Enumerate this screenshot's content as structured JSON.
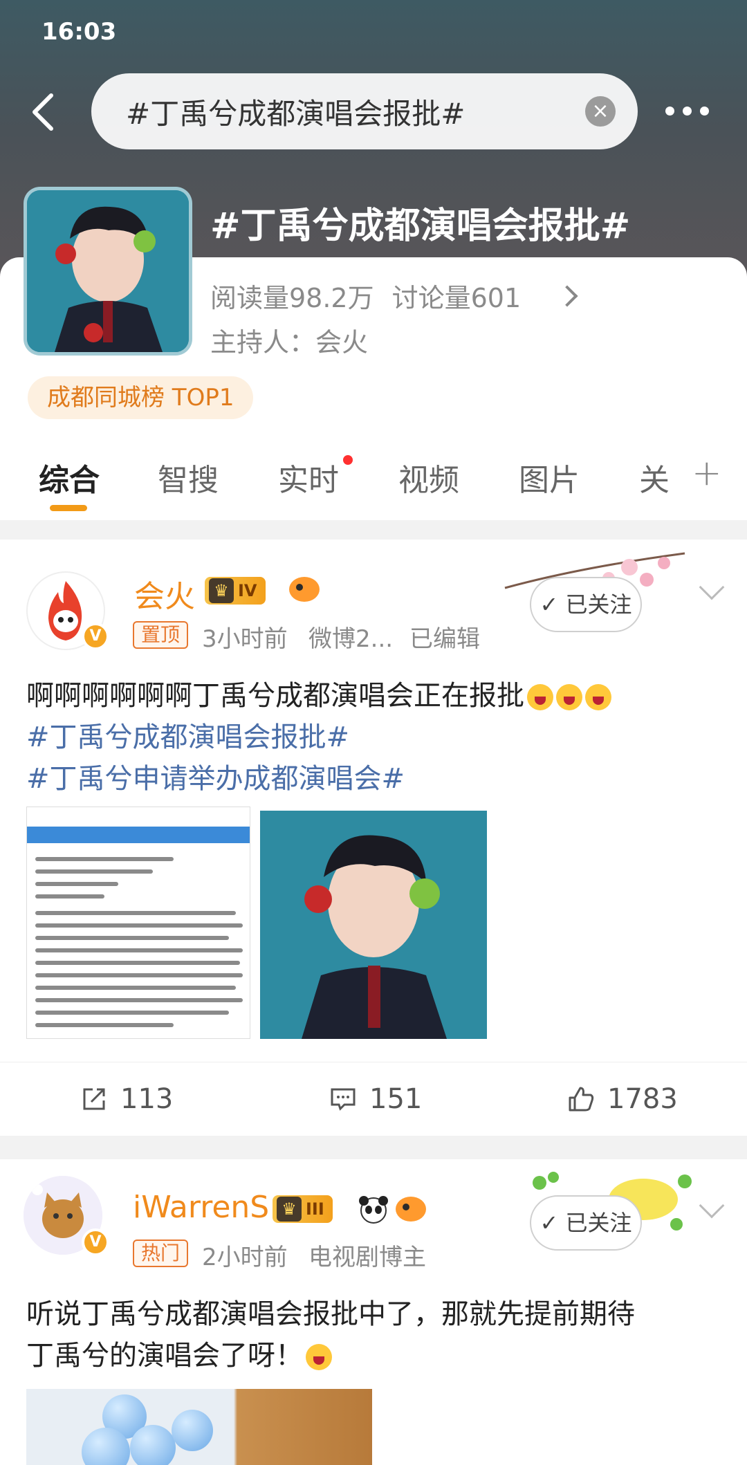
{
  "status": {
    "time": "16:03"
  },
  "search": {
    "query": "#丁禹兮成都演唱会报批#",
    "clear_icon": "close-circle-icon"
  },
  "topic": {
    "title": "#丁禹兮成都演唱会报批#",
    "reads": "阅读量98.2万",
    "discussions": "讨论量601",
    "host": "主持人：会火",
    "rank_badge": "成都同城榜 TOP1"
  },
  "tabs": [
    {
      "label": "综合",
      "active": true
    },
    {
      "label": "智搜"
    },
    {
      "label": "实时",
      "has_dot": true
    },
    {
      "label": "视频"
    },
    {
      "label": "图片"
    },
    {
      "label": "关"
    }
  ],
  "posts": [
    {
      "username": "会火",
      "level": "IV",
      "tag": "置顶",
      "time": "3小时前",
      "source": "微博2...",
      "edited": "已编辑",
      "follow": "已关注",
      "text_line1": "啊啊啊啊啊啊丁禹兮成都演唱会正在报批",
      "hashtag1": "#丁禹兮成都演唱会报批#",
      "hashtag2": "#丁禹兮申请举办成都演唱会#",
      "reposts": "113",
      "comments": "151",
      "likes": "1783"
    },
    {
      "username": "iWarrenS",
      "level": "III",
      "tag": "热门",
      "time": "2小时前",
      "source": "电视剧博主",
      "follow": "已关注",
      "text_line1": "听说丁禹兮成都演唱会报批中了，那就先提前期待",
      "text_line2": "丁禹兮的演唱会了呀！"
    }
  ],
  "colors": {
    "accent": "#f29a17",
    "hashtag": "#4a6ea8",
    "username": "#f08a1c"
  }
}
